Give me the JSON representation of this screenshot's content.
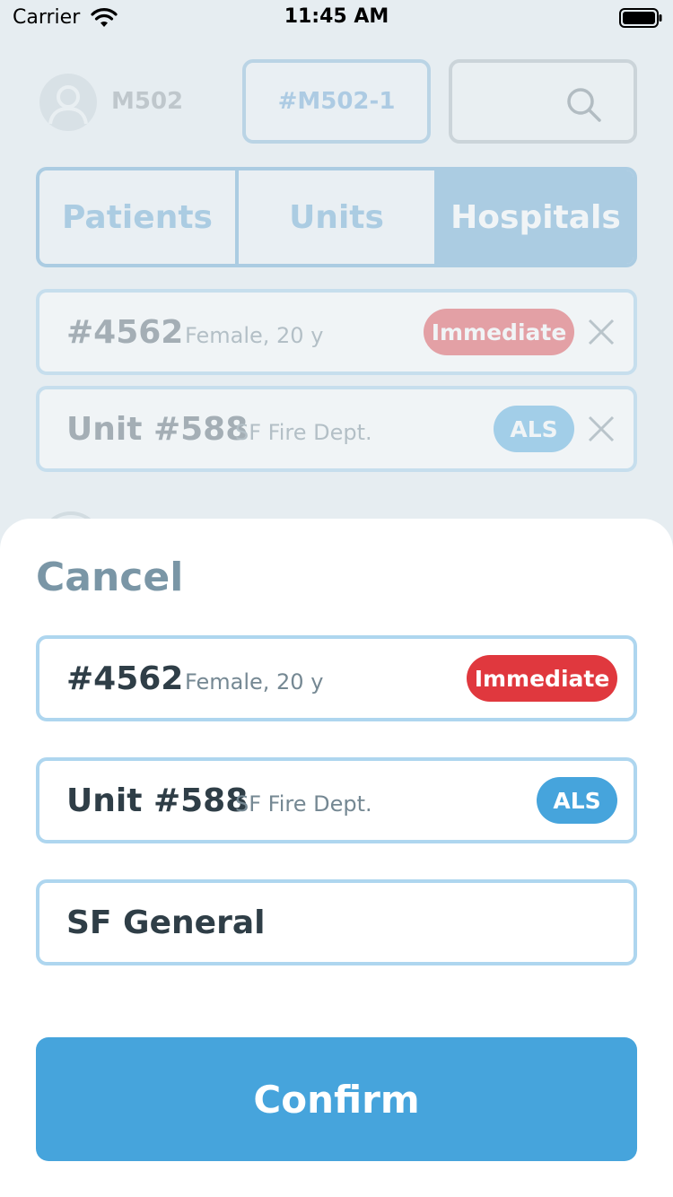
{
  "status_bar": {
    "carrier": "Carrier",
    "time": "11:45 AM"
  },
  "header": {
    "user_id": "M502",
    "incident": "#M502-1"
  },
  "tabs": [
    {
      "label": "Patients",
      "active": false
    },
    {
      "label": "Units",
      "active": false
    },
    {
      "label": "Hospitals",
      "active": true
    }
  ],
  "selected": {
    "patient": {
      "id": "#4562",
      "detail": "Female, 20 y",
      "priority": "Immediate",
      "priority_color": "#e0383e"
    },
    "unit": {
      "id": "Unit #588",
      "detail": "SF Fire Dept.",
      "level": "ALS",
      "level_color": "#46a4dc"
    }
  },
  "sheet": {
    "cancel_label": "Cancel",
    "patient": {
      "id": "#4562",
      "detail": "Female, 20 y",
      "priority": "Immediate",
      "priority_color": "#e0383e"
    },
    "unit": {
      "id": "Unit #588",
      "detail": "SF Fire Dept.",
      "level": "ALS",
      "level_color": "#46a4dc"
    },
    "hospital": {
      "name": "SF General"
    },
    "confirm_label": "Confirm"
  },
  "colors": {
    "accent": "#46a4dc",
    "danger": "#e0383e",
    "backdrop": "#e6edf1"
  }
}
